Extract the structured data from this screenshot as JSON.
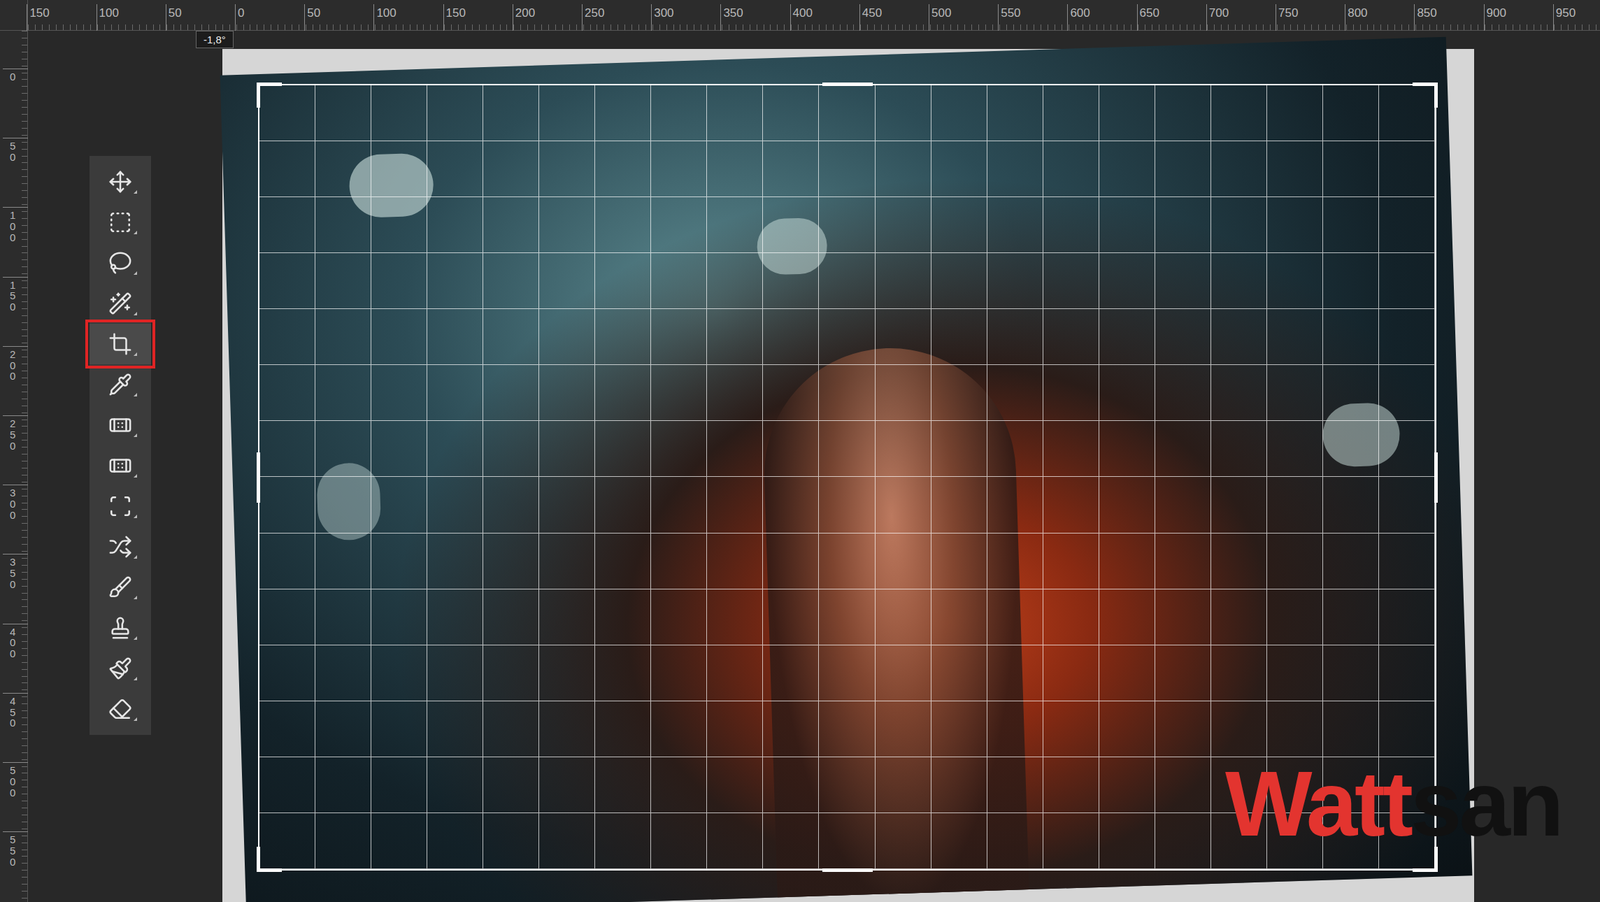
{
  "ruler": {
    "horizontal": [
      "150",
      "100",
      "50",
      "0",
      "50",
      "100",
      "150",
      "200",
      "250",
      "300",
      "350",
      "400",
      "450",
      "500",
      "550",
      "600",
      "650",
      "700",
      "750",
      "800",
      "850",
      "900",
      "950"
    ],
    "vertical": [
      "0",
      "50",
      "100",
      "150",
      "200",
      "250",
      "300",
      "350",
      "400",
      "450",
      "500",
      "550"
    ]
  },
  "tooltip": "-1,8°",
  "tools": [
    {
      "kind": "move",
      "selected": false
    },
    {
      "kind": "marquee",
      "selected": false
    },
    {
      "kind": "lasso",
      "selected": false
    },
    {
      "kind": "magic-wand",
      "selected": false
    },
    {
      "kind": "crop",
      "selected": true
    },
    {
      "kind": "eyedropper",
      "selected": false
    },
    {
      "kind": "spot-healing",
      "selected": false
    },
    {
      "kind": "healing",
      "selected": false
    },
    {
      "kind": "patch",
      "selected": false
    },
    {
      "kind": "content-move",
      "selected": false
    },
    {
      "kind": "brush",
      "selected": false
    },
    {
      "kind": "clone-stamp",
      "selected": false
    },
    {
      "kind": "history-brush",
      "selected": false
    },
    {
      "kind": "eraser",
      "selected": false
    }
  ],
  "watermark": {
    "parts": [
      {
        "text": "Watt",
        "color": "#e3342f"
      },
      {
        "text": "san",
        "color": "#111111"
      }
    ]
  }
}
